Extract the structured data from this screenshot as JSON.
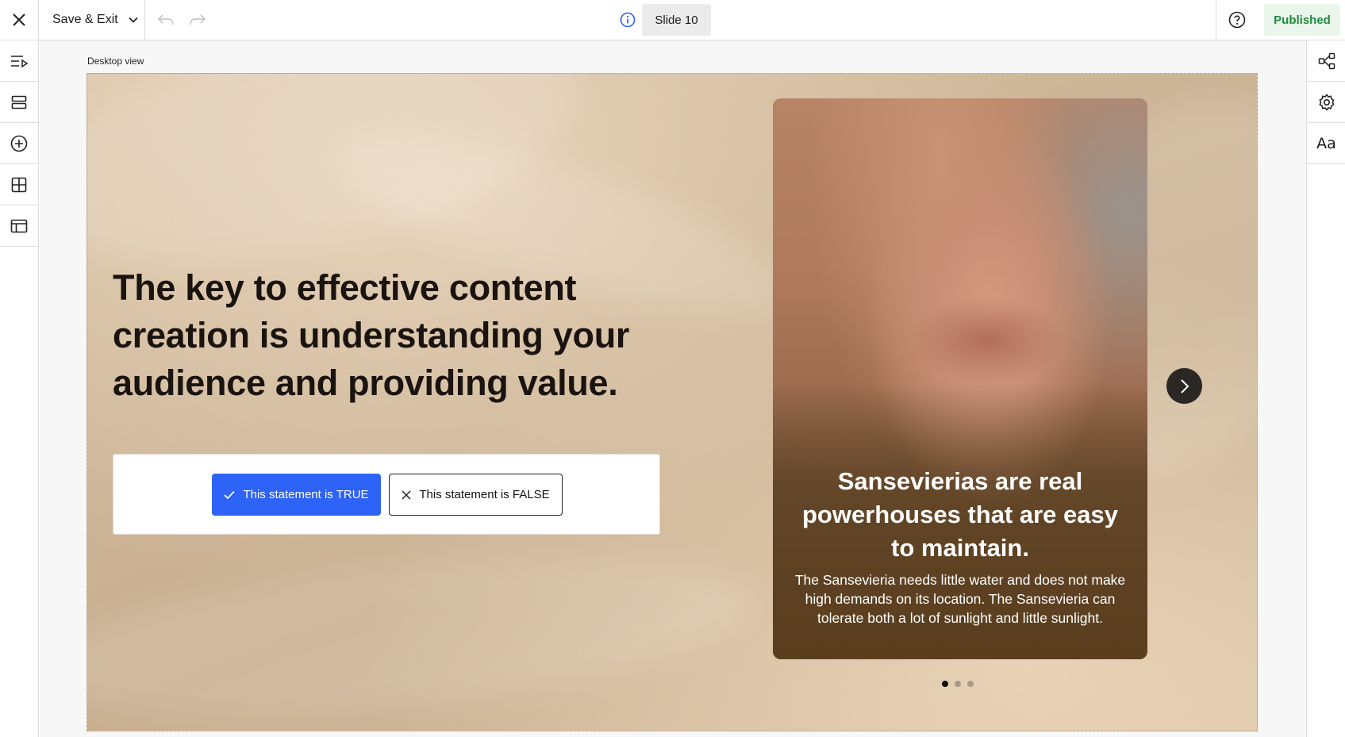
{
  "topbar": {
    "close_icon": "close-icon",
    "save_exit_label": "Save & Exit",
    "slide_label": "Slide 10",
    "status_label": "Published",
    "status_color": "#1f8a3d"
  },
  "left_sidebar": {
    "items": [
      {
        "icon": "playlist-icon"
      },
      {
        "icon": "sections-icon"
      },
      {
        "icon": "add-icon"
      },
      {
        "icon": "grid-icon"
      },
      {
        "icon": "layout-icon"
      }
    ]
  },
  "right_sidebar": {
    "items": [
      {
        "icon": "share-icon"
      },
      {
        "icon": "gear-icon"
      },
      {
        "icon": "typography-icon",
        "label": "Aa"
      }
    ]
  },
  "canvas": {
    "view_label": "Desktop view"
  },
  "slide": {
    "headline": "The key to effective content creation is understanding your audience and providing value.",
    "true_button": "This statement is TRUE",
    "false_button": "This statement is FALSE",
    "accent_color": "#2d63f6",
    "card": {
      "title": "Sansevierias are real powerhouses that are easy to maintain.",
      "text": "The Sansevieria needs little water and does not make high demands on its location. The Sansevieria can tolerate both a lot of sunlight and little sunlight."
    },
    "carousel": {
      "total_pages": 3,
      "active_page": 1
    }
  }
}
